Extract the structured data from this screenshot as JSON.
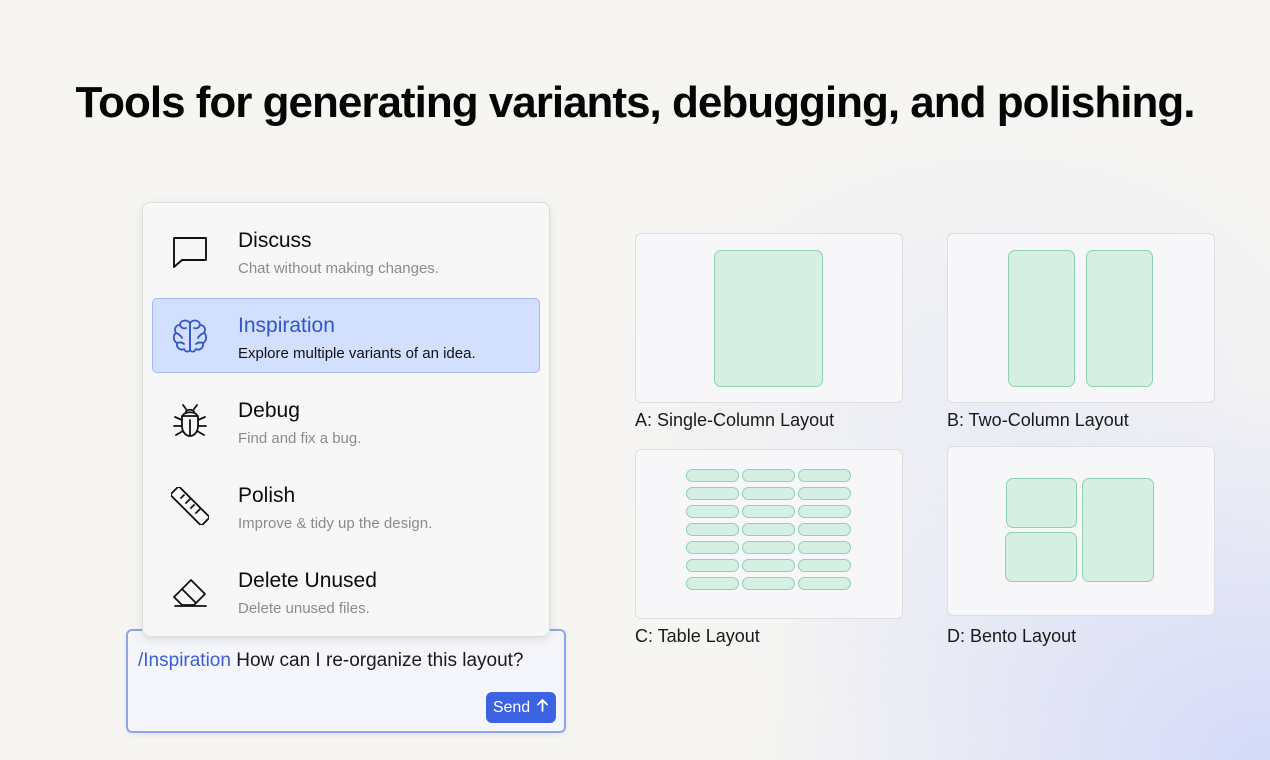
{
  "headline": "Tools for generating variants, debugging, and polishing.",
  "menu": {
    "items": [
      {
        "icon": "chat-bubble-icon",
        "title": "Discuss",
        "description": "Chat without making changes.",
        "active": false
      },
      {
        "icon": "brain-icon",
        "title": "Inspiration",
        "description": "Explore multiple variants of an idea.",
        "active": true
      },
      {
        "icon": "bug-icon",
        "title": "Debug",
        "description": "Find and fix a bug.",
        "active": false
      },
      {
        "icon": "ruler-icon",
        "title": "Polish",
        "description": "Improve & tidy up the design.",
        "active": false
      },
      {
        "icon": "eraser-icon",
        "title": "Delete Unused",
        "description": "Delete unused files.",
        "active": false
      }
    ]
  },
  "prompt": {
    "command": "/Inspiration",
    "text": " How can I re-organize this layout?",
    "send_label": "Send",
    "send_icon": "arrow-up-icon"
  },
  "layouts": [
    {
      "label": "A: Single-Column Layout"
    },
    {
      "label": "B: Two-Column Layout"
    },
    {
      "label": "C: Table Layout"
    },
    {
      "label": "D: Bento Layout"
    }
  ],
  "colors": {
    "accent": "#3c64e2",
    "active_item_bg": "#d3dfff",
    "active_item_text": "#3355c9",
    "block_fill": "#d5efe2",
    "block_border": "#8fd1b0"
  }
}
